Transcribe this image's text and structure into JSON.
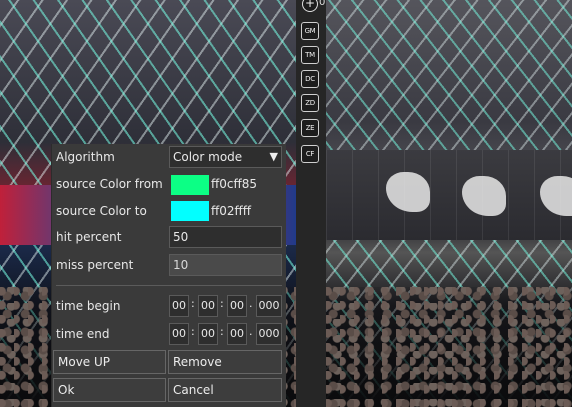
{
  "toolbar": {
    "add_label": "+",
    "buttons": [
      "GM",
      "TM",
      "DC",
      "ZD",
      "ZE",
      "CF"
    ],
    "corner_text": "0"
  },
  "dialog": {
    "algorithm_label": "Algorithm",
    "algorithm_value": "Color mode",
    "source_from_label": "source Color from",
    "source_from_color": "#0cff85",
    "source_from_hex": "ff0cff85",
    "source_to_label": "source Color to",
    "source_to_color": "#02ffff",
    "source_to_hex": "ff02ffff",
    "hit_label": "hit percent",
    "hit_value": "50",
    "miss_label": "miss percent",
    "miss_value": "10",
    "time_begin_label": "time begin",
    "time_begin": [
      "00",
      "00",
      "00",
      "000"
    ],
    "time_end_label": "time end",
    "time_end": [
      "00",
      "00",
      "00",
      "000"
    ],
    "move_up_label": "Move UP",
    "remove_label": "Remove",
    "ok_label": "Ok",
    "cancel_label": "Cancel"
  }
}
